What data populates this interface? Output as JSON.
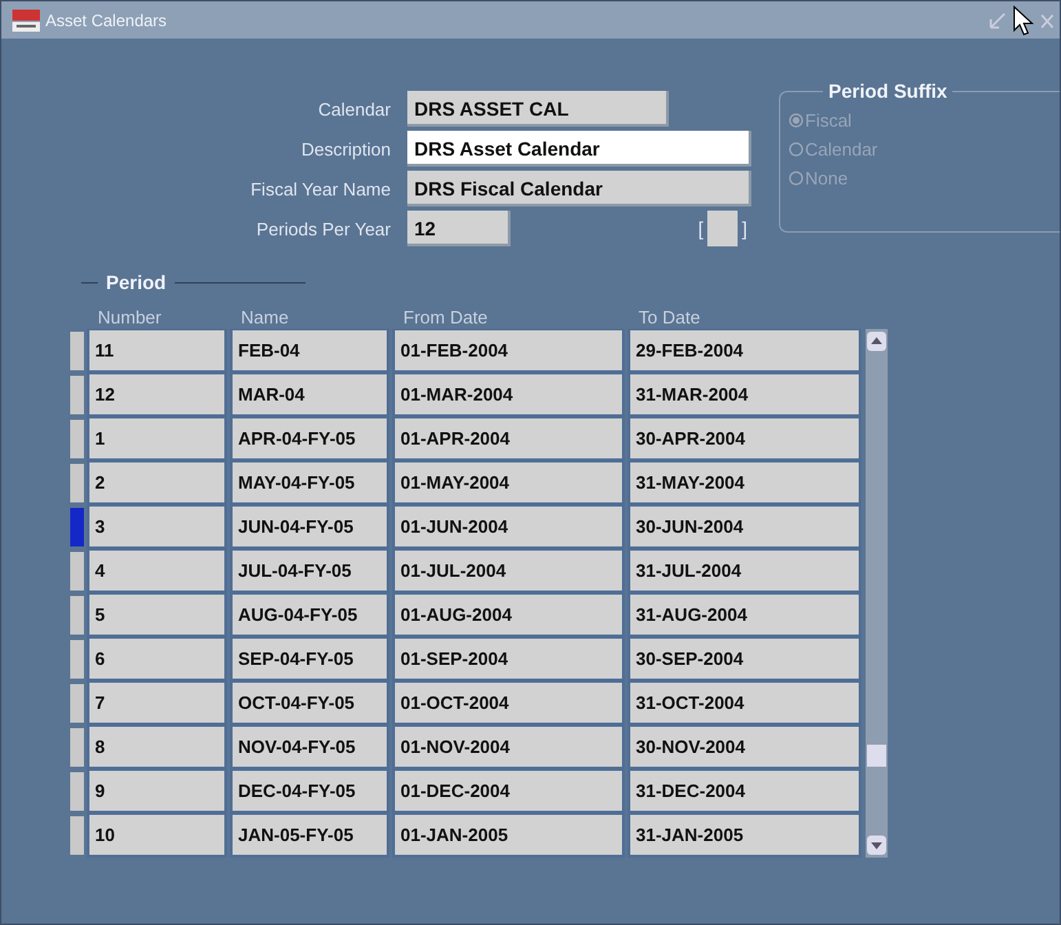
{
  "window": {
    "title": "Asset Calendars"
  },
  "fields": [
    {
      "label": "Calendar",
      "value": "DRS ASSET CAL",
      "kind": "readonly"
    },
    {
      "label": "Description",
      "value": "DRS Asset Calendar",
      "kind": "editable"
    },
    {
      "label": "Fiscal Year Name",
      "value": "DRS Fiscal Calendar",
      "kind": "readonly"
    },
    {
      "label": "Periods Per Year",
      "value": "12",
      "kind": "readonly"
    }
  ],
  "bracket_field": {
    "open": "[",
    "close": "]"
  },
  "period_suffix": {
    "title": "Period Suffix",
    "options": [
      {
        "label": "Fiscal",
        "selected": true
      },
      {
        "label": "Calendar",
        "selected": false
      },
      {
        "label": "None",
        "selected": false
      }
    ]
  },
  "period": {
    "title": "Period",
    "columns": [
      "Number",
      "Name",
      "From Date",
      "To Date"
    ],
    "rows": [
      {
        "cells": [
          "11",
          "FEB-04",
          "01-FEB-2004",
          "29-FEB-2004"
        ],
        "selected": false
      },
      {
        "cells": [
          "12",
          "MAR-04",
          "01-MAR-2004",
          "31-MAR-2004"
        ],
        "selected": false
      },
      {
        "cells": [
          "1",
          "APR-04-FY-05",
          "01-APR-2004",
          "30-APR-2004"
        ],
        "selected": false
      },
      {
        "cells": [
          "2",
          "MAY-04-FY-05",
          "01-MAY-2004",
          "31-MAY-2004"
        ],
        "selected": false
      },
      {
        "cells": [
          "3",
          "JUN-04-FY-05",
          "01-JUN-2004",
          "30-JUN-2004"
        ],
        "selected": true
      },
      {
        "cells": [
          "4",
          "JUL-04-FY-05",
          "01-JUL-2004",
          "31-JUL-2004"
        ],
        "selected": false
      },
      {
        "cells": [
          "5",
          "AUG-04-FY-05",
          "01-AUG-2004",
          "31-AUG-2004"
        ],
        "selected": false
      },
      {
        "cells": [
          "6",
          "SEP-04-FY-05",
          "01-SEP-2004",
          "30-SEP-2004"
        ],
        "selected": false
      },
      {
        "cells": [
          "7",
          "OCT-04-FY-05",
          "01-OCT-2004",
          "31-OCT-2004"
        ],
        "selected": false
      },
      {
        "cells": [
          "8",
          "NOV-04-FY-05",
          "01-NOV-2004",
          "30-NOV-2004"
        ],
        "selected": false
      },
      {
        "cells": [
          "9",
          "DEC-04-FY-05",
          "01-DEC-2004",
          "31-DEC-2004"
        ],
        "selected": false
      },
      {
        "cells": [
          "10",
          "JAN-05-FY-05",
          "01-JAN-2005",
          "31-JAN-2005"
        ],
        "selected": false
      }
    ]
  }
}
